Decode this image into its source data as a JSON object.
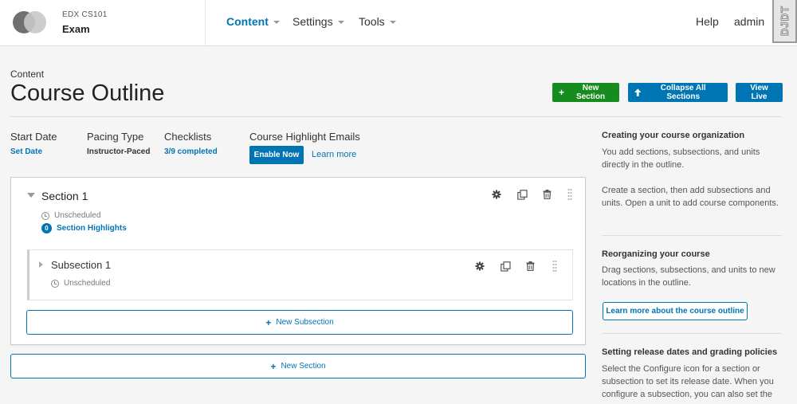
{
  "header": {
    "course_org": "EDX  CS101",
    "course_name": "Exam",
    "nav": [
      {
        "label": "Content",
        "active": true
      },
      {
        "label": "Settings",
        "active": false
      },
      {
        "label": "Tools",
        "active": false
      }
    ],
    "help": "Help",
    "user": "admin",
    "debug_toolbar": "DJDT"
  },
  "page": {
    "breadcrumb": "Content",
    "title": "Course Outline",
    "buttons": {
      "new_section": "New Section",
      "collapse_all": "Collapse All Sections",
      "view_live": "View Live"
    }
  },
  "status": {
    "start_date": {
      "label": "Start Date",
      "value": "Set Date"
    },
    "pacing": {
      "label": "Pacing Type",
      "value": "Instructor-Paced"
    },
    "checklists": {
      "label": "Checklists",
      "value": "3/9 completed"
    },
    "highlights": {
      "label": "Course Highlight Emails",
      "enable": "Enable Now",
      "learn_more": "Learn more"
    }
  },
  "outline": {
    "section": {
      "title": "Section 1",
      "schedule": "Unscheduled",
      "highlights_count": "0",
      "highlights_label": "Section Highlights"
    },
    "subsection": {
      "title": "Subsection 1",
      "schedule": "Unscheduled"
    },
    "new_subsection": "New Subsection",
    "new_section": "New Section"
  },
  "sidebar": {
    "h1": "Creating your course organization",
    "p1": "You add sections, subsections, and units directly in the outline.",
    "p2": "Create a section, then add subsections and units. Open a unit to add course components.",
    "h2": "Reorganizing your course",
    "p3": "Drag sections, subsections, and units to new locations in the outline.",
    "button": "Learn more about the course outline",
    "h3": "Setting release dates and grading policies",
    "p4": "Select the Configure icon for a section or subsection to set its release date. When you configure a subsection, you can also set the"
  },
  "colors": {
    "primary": "#0075b4",
    "success": "#178c1e",
    "text": "#313131"
  }
}
